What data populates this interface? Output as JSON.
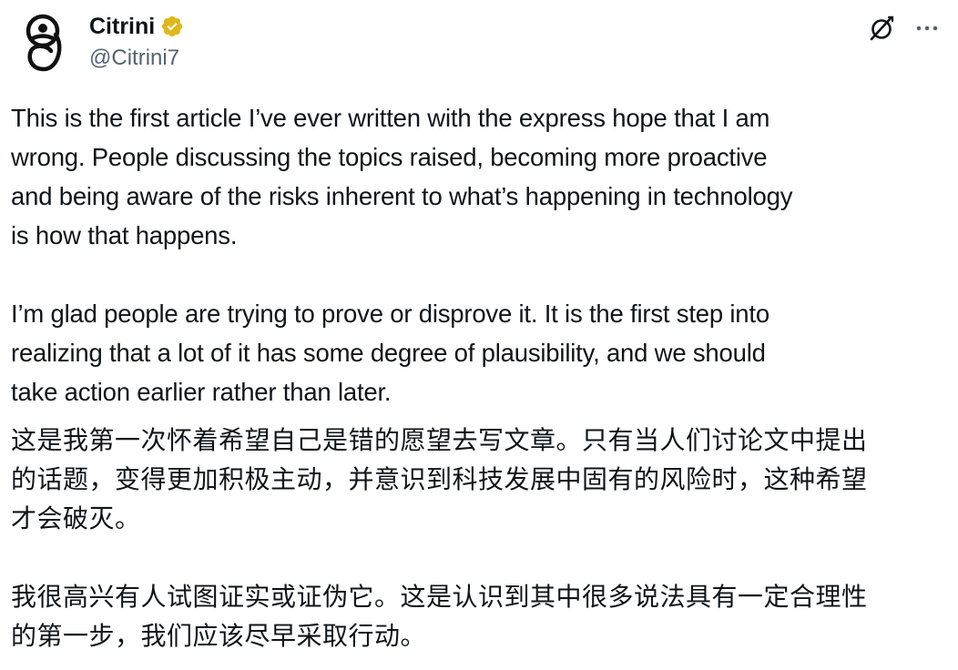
{
  "author": {
    "display_name": "Citrini",
    "handle": "@Citrini7",
    "verified_color": "#e2b719"
  },
  "icons": {
    "avatar": "citrini-logo-icon",
    "verified": "verified-badge-icon",
    "grok": "grok-icon",
    "more": "more-options-icon"
  },
  "tweet": {
    "en_paragraphs": [
      "This is the first article I’ve ever written with the express hope that I am\nwrong. People discussing the topics raised, becoming more proactive\nand being aware of the risks inherent to what’s happening in technology\nis how that happens.",
      "I’m glad people are trying to prove or disprove it. It is the first step into\nrealizing that a lot of it has some degree of plausibility, and we should\ntake action earlier rather than later."
    ],
    "zh_paragraphs": [
      "这是我第一次怀着希望自己是错的愿望去写文章。只有当人们讨论文中提出\n的话题，变得更加积极主动，并意识到科技发展中固有的风险时，这种希望\n才会破灭。",
      "我很高兴有人试图证实或证伪它。这是认识到其中很多说法具有一定合理性\n的第一步，我们应该尽早采取行动。"
    ]
  }
}
